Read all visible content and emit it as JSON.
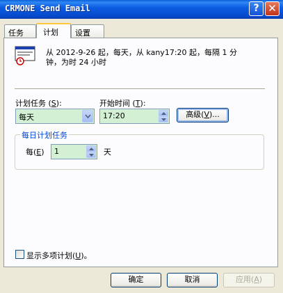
{
  "window": {
    "title": "CRMONE Send Email",
    "help_glyph": "?",
    "close_glyph": "✕"
  },
  "tabs": [
    "任务",
    "计划",
    "设置"
  ],
  "active_tab": "计划",
  "summary": {
    "line1": "从 2012-9-26 起，每天，从 kany17:20 起，每隔 1 分",
    "line2": "钟，为时 24 小时"
  },
  "schedule_task": {
    "label_pre": "计划任务 (",
    "label_key": "S",
    "label_post": "):",
    "value": "每天"
  },
  "start_time": {
    "label_pre": "开始时间 (",
    "label_key": "T",
    "label_post": "):",
    "value": "17:20"
  },
  "advanced_button": {
    "pre": "高级(",
    "key": "V",
    "post": ")..."
  },
  "daily_group": {
    "title": "每日计划任务",
    "every_pre": "每(",
    "every_key": "E",
    "every_post": ")",
    "value": "1",
    "unit": "天"
  },
  "show_multiple": {
    "pre": "显示多项计划(",
    "key": "U",
    "post": ")。",
    "checked": false
  },
  "buttons": {
    "ok": "确定",
    "cancel": "取消",
    "apply_pre": "应用(",
    "apply_key": "A",
    "apply_post": ")"
  },
  "colors": {
    "title_bar": "#0a5fd9",
    "input_bg": "#d4f0d4",
    "group_title": "#0046d5"
  }
}
